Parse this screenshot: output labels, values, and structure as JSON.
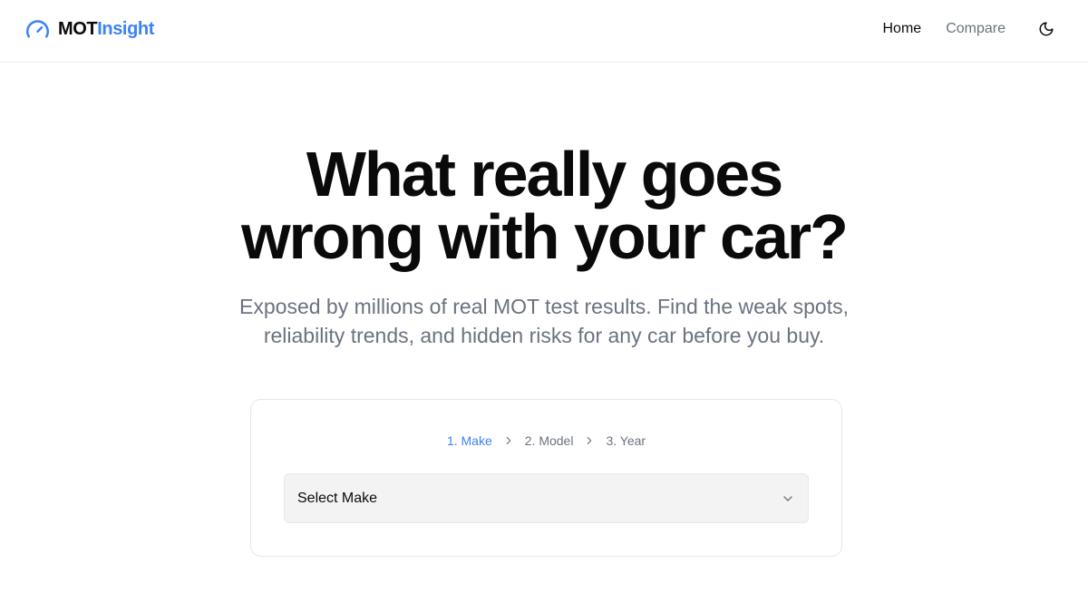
{
  "header": {
    "logo": {
      "part1": "MOT",
      "part2": "Insight",
      "icon": "gauge-icon"
    },
    "nav": [
      {
        "label": "Home",
        "active": true
      },
      {
        "label": "Compare",
        "active": false
      }
    ],
    "theme_toggle_icon": "moon-icon"
  },
  "hero": {
    "title_line1": "What really goes",
    "title_line2": "wrong with your car?",
    "subtitle": "Exposed by millions of real MOT test results. Find the weak spots, reliability trends, and hidden risks for any car before you buy."
  },
  "selector": {
    "steps": [
      {
        "label": "1. Make",
        "active": true
      },
      {
        "label": "2. Model",
        "active": false
      },
      {
        "label": "3. Year",
        "active": false
      }
    ],
    "separator_icon": "chevron-right-icon",
    "dropdown": {
      "value": "Select Make",
      "icon": "chevron-down-icon"
    }
  },
  "colors": {
    "accent": "#3b82f6",
    "text": "#0a0a0a",
    "muted": "#6b7280",
    "border": "#e5e7eb",
    "select_bg": "#f3f3f3"
  }
}
